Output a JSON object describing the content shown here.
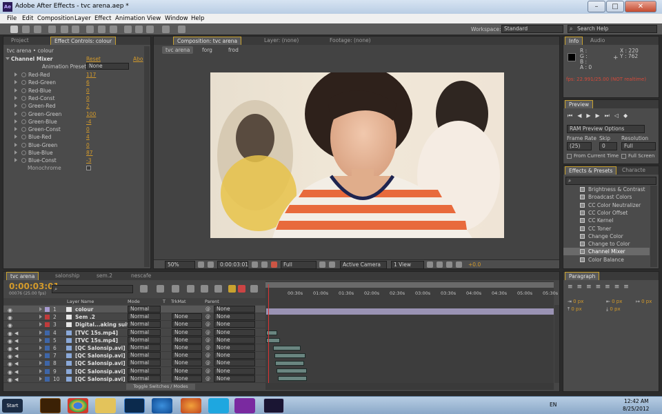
{
  "window": {
    "title": "Adobe After Effects - tvc arena.aep *",
    "app_icon": "Ae"
  },
  "menu": [
    "File",
    "Edit",
    "Composition",
    "Layer",
    "Effect",
    "Animation",
    "View",
    "Window",
    "Help"
  ],
  "toolbar": {
    "workspace_label": "Workspace:",
    "workspace_value": "Standard",
    "search_placeholder": "Search Help"
  },
  "project_panel": {
    "tab_project": "Project",
    "tab_effect_controls": "Effect Controls: colour",
    "breadcrumb": "tvc arena • colour",
    "effect_name": "Channel Mixer",
    "reset": "Reset",
    "about": "Abo",
    "presets_label": "Animation Presets:",
    "presets_value": "None",
    "params": [
      {
        "name": "Red-Red",
        "value": "117"
      },
      {
        "name": "Red-Green",
        "value": "6"
      },
      {
        "name": "Red-Blue",
        "value": "0"
      },
      {
        "name": "Red-Const",
        "value": "0"
      },
      {
        "name": "Green-Red",
        "value": "2"
      },
      {
        "name": "Green-Green",
        "value": "100"
      },
      {
        "name": "Green-Blue",
        "value": "-4"
      },
      {
        "name": "Green-Const",
        "value": "0"
      },
      {
        "name": "Blue-Red",
        "value": "4"
      },
      {
        "name": "Blue-Green",
        "value": "0"
      },
      {
        "name": "Blue-Blue",
        "value": "87"
      },
      {
        "name": "Blue-Const",
        "value": "-3"
      }
    ],
    "monochrome": "Monochrome"
  },
  "comp_panel": {
    "tab_comp": "Composition: tvc arena",
    "tab_layer": "Layer: (none)",
    "tab_footage": "Footage: (none)",
    "crumbs": [
      "tvc arena",
      "forg",
      "frod"
    ],
    "footer": {
      "zoom": "50%",
      "timecode": "0:00:03:01",
      "resolution": "Full",
      "camera": "Active Camera",
      "views": "1 View",
      "exposure": "+0.0"
    }
  },
  "info_panel": {
    "tab_info": "Info",
    "tab_audio": "Audio",
    "r": "R :",
    "g": "G :",
    "b": "B :",
    "a": "A : 0",
    "x": "X : 220",
    "y": "Y : 762",
    "fps": "fps: 22.991/25.00 (NOT realtime)"
  },
  "preview_panel": {
    "tab": "Preview",
    "ram_options": "RAM Preview Options",
    "frame_rate_label": "Frame Rate",
    "skip_label": "Skip",
    "resolution_label": "Resolution",
    "frame_rate": "(25)",
    "skip": "0",
    "resolution": "Full",
    "from_current": "From Current Time",
    "full_screen": "Full Screen"
  },
  "effects_panel": {
    "tab": "Effects & Presets",
    "tab2": "Characte",
    "items": [
      "Brightness & Contrast",
      "Broadcast Colors",
      "CC Color Neutralizer",
      "CC Color Offset",
      "CC Kernel",
      "CC Toner",
      "Change Color",
      "Change to Color",
      "Channel Mixer",
      "Color Balance"
    ]
  },
  "paragraph_panel": {
    "tab": "Paragraph",
    "v1": "0 px",
    "v2": "0 px",
    "v3": "0 px",
    "v4": "0 px",
    "v5": "0 px"
  },
  "timeline": {
    "tabs": [
      "tvc arena",
      "salonship",
      "sem.2",
      "nescafe"
    ],
    "timecode": "0:00:03:01",
    "frame_info": "00076 (25.00 fps)",
    "headers": {
      "source": "Layer Name",
      "mode": "Mode",
      "t": "T",
      "trkmat": "TrkMat",
      "parent": "Parent"
    },
    "ruler": [
      "00:30s",
      "01:00s",
      "01:30s",
      "02:00s",
      "02:30s",
      "03:00s",
      "03:30s",
      "04:00s",
      "04:30s",
      "05:00s",
      "05:30s"
    ],
    "layers": [
      {
        "num": "1",
        "name": "colour",
        "mode": "Normal",
        "trk": "",
        "parent": "None"
      },
      {
        "num": "2",
        "name": "Sem .2",
        "mode": "Normal",
        "trk": "None",
        "parent": "None"
      },
      {
        "num": "3",
        "name": "Digital...aking suit",
        "mode": "Normal",
        "trk": "None",
        "parent": "None"
      },
      {
        "num": "4",
        "name": "[TVC 15s.mp4]",
        "mode": "Normal",
        "trk": "None",
        "parent": "None"
      },
      {
        "num": "5",
        "name": "[TVC 15s.mp4]",
        "mode": "Normal",
        "trk": "None",
        "parent": "None"
      },
      {
        "num": "6",
        "name": "[QC Salonsip.avi]",
        "mode": "Normal",
        "trk": "None",
        "parent": "None"
      },
      {
        "num": "7",
        "name": "[QC Salonsip.avi]",
        "mode": "Normal",
        "trk": "None",
        "parent": "None"
      },
      {
        "num": "8",
        "name": "[QC Salonsip.avi]",
        "mode": "Normal",
        "trk": "None",
        "parent": "None"
      },
      {
        "num": "9",
        "name": "[QC Salonsip.avi]",
        "mode": "Normal",
        "trk": "None",
        "parent": "None"
      },
      {
        "num": "10",
        "name": "[QC Salonsip.avi]",
        "mode": "Normal",
        "trk": "None",
        "parent": "None"
      }
    ],
    "toggle": "Toggle Switches / Modes"
  },
  "taskbar": {
    "start": "Start",
    "lang": "EN",
    "time": "12:42 AM",
    "date": "8/25/2012"
  }
}
